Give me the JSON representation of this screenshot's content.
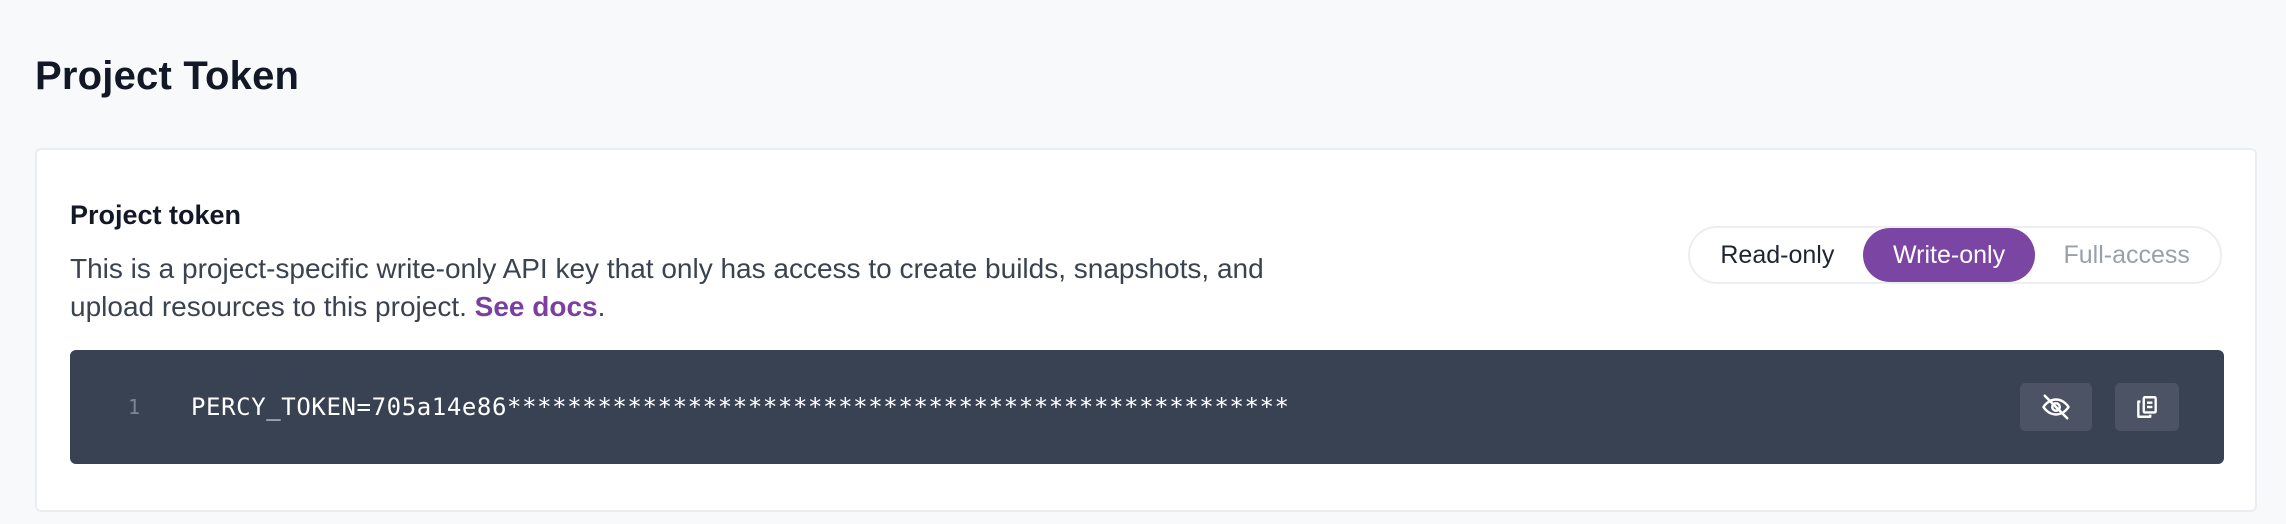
{
  "page": {
    "title": "Project Token"
  },
  "token_card": {
    "title": "Project token",
    "description_prefix": "This is a project-specific write-only API key that only has access to create builds, snapshots, and upload resources to this project. ",
    "docs_link": "See docs",
    "description_suffix": "."
  },
  "access_toggle": {
    "options": [
      "Read-only",
      "Write-only",
      "Full-access"
    ],
    "selected": "Write-only"
  },
  "code": {
    "line_number": "1",
    "text": "PERCY_TOKEN=705a14e86****************************************************"
  },
  "icons": {
    "hide": "eye-slash-icon",
    "copy": "copy-icon"
  },
  "colors": {
    "accent": "#7b45a3",
    "link": "#7b3fa0",
    "code_background": "#394253",
    "icon_button": "#4b5364"
  }
}
